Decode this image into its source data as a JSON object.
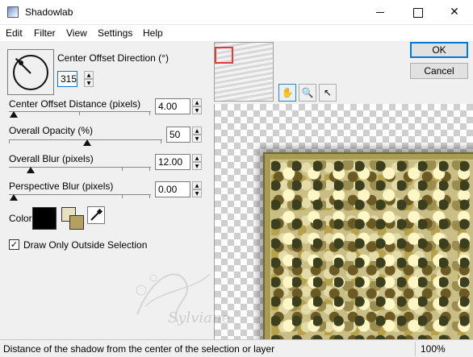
{
  "window": {
    "title": "Shadowlab",
    "minimize_icon": "minimize-icon",
    "maximize_icon": "maximize-icon",
    "close_glyph": "✕"
  },
  "menu": [
    "Edit",
    "Filter",
    "View",
    "Settings",
    "Help"
  ],
  "buttons": {
    "ok": "OK",
    "cancel": "Cancel"
  },
  "tools": [
    {
      "name": "pan-hand-icon",
      "glyph": "✋"
    },
    {
      "name": "zoom-magnifier-icon",
      "glyph": "🔍"
    },
    {
      "name": "arrow-pointer-icon",
      "glyph": "↖"
    }
  ],
  "controls": {
    "direction": {
      "label": "Center Offset Direction (°)",
      "value": "315"
    },
    "distance": {
      "label": "Center Offset Distance (pixels)",
      "value": "4.00"
    },
    "opacity": {
      "label": "Overall Opacity (%)",
      "value": "50"
    },
    "blur": {
      "label": "Overall Blur (pixels)",
      "value": "12.00"
    },
    "perspective": {
      "label": "Perspective Blur (pixels)",
      "value": "0.00"
    }
  },
  "color": {
    "label": "Color",
    "primary": "#000000",
    "secondary": "#e8e0c4",
    "tertiary": "#b5a060",
    "eyedropper_icon": "eyedropper-icon"
  },
  "checkbox": {
    "label": "Draw Only Outside Selection",
    "checked": true,
    "check_glyph": "✓"
  },
  "watermark_text": "Sylviane",
  "status": {
    "text": "Distance of the shadow from the center of the selection or layer",
    "zoom": "100%"
  }
}
